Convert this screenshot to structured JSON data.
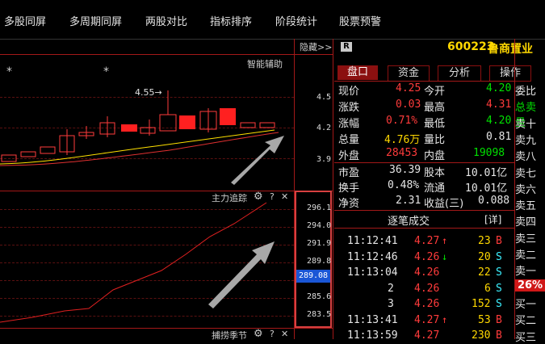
{
  "menu": [
    "多股同屏",
    "多周期同屏",
    "两股对比",
    "指标排序",
    "阶段统计",
    "股票预警"
  ],
  "top_chart": {
    "hide_label": "隐藏>>",
    "assist_label": "智能辅助",
    "star": "*",
    "high_annotation": "4.55→",
    "price_labels": [
      "4.5",
      "4.2",
      "3.9"
    ]
  },
  "indicator": {
    "title": "主力追踪",
    "gear_icon": "gear-icon",
    "help": "?",
    "close": "✕",
    "values": [
      "296.1",
      "294.0",
      "291.9",
      "289.8",
      "289.08",
      "285.6",
      "283.5"
    ],
    "current_value": "289.08",
    "current_color": "#1a56d6",
    "bottom_title": "捕捞季节"
  },
  "stock": {
    "badge": "R",
    "code": "600223",
    "name": "鲁商置业"
  },
  "tabs": [
    "盘口",
    "资金",
    "分析",
    "操作"
  ],
  "quote": {
    "now_label": "现价",
    "now": "4.25",
    "open_label": "今开",
    "open": "4.20",
    "chg_label": "涨跌",
    "chg": "0.03",
    "high_label": "最高",
    "high": "4.31",
    "pct_label": "涨幅",
    "pct": "0.71%",
    "low_label": "最低",
    "low": "4.20",
    "vol_label": "总量",
    "vol": "4.76万",
    "ratio_label": "量比",
    "ratio": "0.81",
    "out_label": "外盘",
    "out": "28453",
    "in_label": "内盘",
    "in": "19098",
    "pe_label": "市盈",
    "pe": "36.39",
    "cap_label": "股本",
    "cap": "10.01亿",
    "turn_label": "换手",
    "turn": "0.48%",
    "float_label": "流通",
    "float": "10.01亿",
    "nav_label": "净资",
    "nav": "2.31",
    "eps_label": "收益(三)",
    "eps": "0.088"
  },
  "ticks_header": {
    "title": "逐笔成交",
    "detail": "[详]"
  },
  "ticks": [
    {
      "time": "11:12:41",
      "price": "4.27",
      "arrow": "↑",
      "vol": "23",
      "side": "B"
    },
    {
      "time": "11:12:46",
      "price": "4.26",
      "arrow": "↓",
      "vol": "20",
      "side": "S"
    },
    {
      "time": "11:13:04",
      "price": "4.26",
      "arrow": "",
      "vol": "22",
      "side": "S"
    },
    {
      "time": "2",
      "price": "4.26",
      "arrow": "",
      "vol": "6",
      "side": "S"
    },
    {
      "time": "3",
      "price": "4.26",
      "arrow": "",
      "vol": "152",
      "side": "S"
    },
    {
      "time": "11:13:41",
      "price": "4.27",
      "arrow": "↑",
      "vol": "53",
      "side": "B"
    },
    {
      "time": "11:13:59",
      "price": "4.27",
      "arrow": "",
      "vol": "230",
      "side": "B"
    }
  ],
  "side_list": [
    "委比",
    "总卖量",
    "卖十",
    "卖九",
    "卖八",
    "卖七",
    "卖六",
    "卖五",
    "卖四",
    "卖三",
    "卖二",
    "卖一",
    "26%",
    "买一",
    "买二",
    "买三"
  ]
}
